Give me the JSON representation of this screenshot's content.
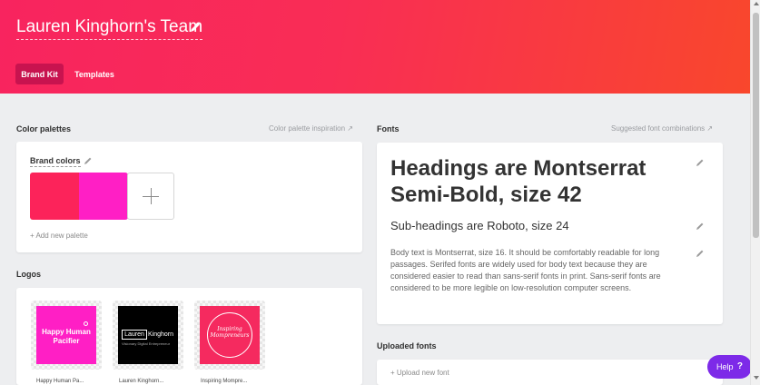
{
  "header": {
    "team_title": "Lauren Kinghorn's Team",
    "tabs": [
      {
        "label": "Brand Kit",
        "active": true
      },
      {
        "label": "Templates",
        "active": false
      }
    ],
    "gradient": [
      "#f8245f",
      "#f9472c"
    ]
  },
  "color_palettes": {
    "section_title": "Color palettes",
    "inspiration_link": "Color palette inspiration ↗",
    "brand_colors_title": "Brand colors",
    "swatches": [
      "#fc235a",
      "#ff1fc5"
    ],
    "add_palette": "+ Add new palette"
  },
  "logos": {
    "section_title": "Logos",
    "items": [
      {
        "art_text": "Happy Human Pacifier",
        "caption": "Happy Human Pa..."
      },
      {
        "art_text_box": "Lauren",
        "art_text_rest": "Kinghorn",
        "art_sub": "Visionary Digital Entrepreneur",
        "caption": "Lauren Kinghorn..."
      },
      {
        "art_text": "Inspiring Mompreneurs",
        "caption": "Inspiring Mompre..."
      }
    ]
  },
  "fonts": {
    "section_title": "Fonts",
    "suggested_link": "Suggested font combinations ↗",
    "heading_sample": "Headings are Montserrat Semi-Bold, size 42",
    "subheading_sample": "Sub-headings are Roboto, size 24",
    "body_sample": "Body text is Montserrat, size 16. It should be comfortably readable for long passages. Serifed fonts are widely used for body text because they are considered easier to read than sans-serif fonts in print. Sans-serif fonts are considered to be more legible on low-resolution computer screens."
  },
  "uploaded_fonts": {
    "section_title": "Uploaded fonts",
    "upload_link": "+ Upload new font"
  },
  "help": {
    "label": "Help",
    "icon": "?",
    "color": "#7d2ae8"
  }
}
